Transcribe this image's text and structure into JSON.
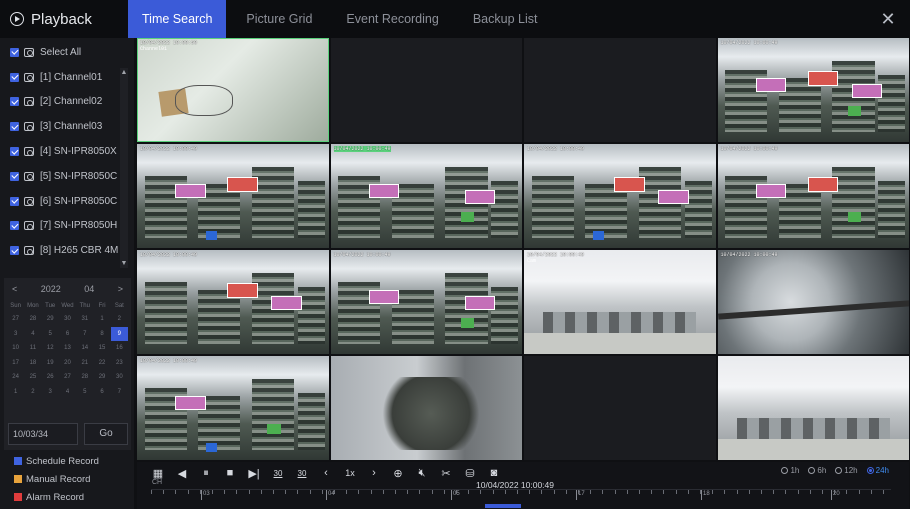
{
  "app": {
    "title": "Playback"
  },
  "tabs": [
    {
      "label": "Time Search",
      "active": true
    },
    {
      "label": "Picture Grid",
      "active": false
    },
    {
      "label": "Event Recording",
      "active": false
    },
    {
      "label": "Backup List",
      "active": false
    }
  ],
  "sidebar": {
    "select_all": "Select All",
    "channels": [
      "[1] Channel01",
      "[2] Channel02",
      "[3] Channel03",
      "[4] SN-IPR8050X",
      "[5] SN-IPR8050C",
      "[6] SN-IPR8050C",
      "[7] SN-IPR8050H",
      "[8] H265 CBR 4M"
    ]
  },
  "calendar": {
    "year": "2022",
    "month": "04",
    "prev": "<",
    "next": ">",
    "weekdays": [
      "Sun",
      "Mon",
      "Tue",
      "Wed",
      "Thu",
      "Fri",
      "Sat"
    ],
    "days": [
      "27",
      "28",
      "29",
      "30",
      "31",
      "1",
      "2",
      "3",
      "4",
      "5",
      "6",
      "7",
      "8",
      "9",
      "10",
      "11",
      "12",
      "13",
      "14",
      "15",
      "16",
      "17",
      "18",
      "19",
      "20",
      "21",
      "22",
      "23",
      "24",
      "25",
      "26",
      "27",
      "28",
      "29",
      "30",
      "1",
      "2",
      "3",
      "4",
      "5",
      "6",
      "7"
    ],
    "selected_index": 13,
    "date_input": "10/03/34",
    "go": "Go"
  },
  "legend": [
    {
      "label": "Schedule Record",
      "color": "#3f63e0"
    },
    {
      "label": "Manual Record",
      "color": "#e8a33c"
    },
    {
      "label": "Alarm Record",
      "color": "#e03c3c"
    }
  ],
  "osd": {
    "c1": "10/04/2022 10:00:50",
    "c1b": "Channel01",
    "c4": "10/04/2022 10:00:49",
    "c5": "10/04/2022 10:00:49",
    "c6": "10/04/2022 10:00:49",
    "c7": "10/04/2022 10:00:49",
    "c8": "10/04/2022 10:00:49",
    "c9": "10/04/2022 10:00:49",
    "c10": "10/04/2022 10:00:49",
    "c11": "10/04/2022 10:00:49",
    "c11b": "Cam",
    "c12": "10/04/2022 10:00:49",
    "c13": "10/04/2022 10:00:49"
  },
  "controls": {
    "ch_label": "CH",
    "speed": "1x",
    "skip30_back": "30",
    "skip30_fwd": "30",
    "timestamp": "10/04/2022 10:00:49",
    "ranges": [
      {
        "label": "1h",
        "on": false
      },
      {
        "label": "6h",
        "on": false
      },
      {
        "label": "12h",
        "on": false
      },
      {
        "label": "24h",
        "on": true
      }
    ],
    "timeline_labels": [
      "03",
      "04",
      "05",
      "17",
      "18",
      "20"
    ]
  },
  "colors": {
    "accent": "#3b5bd8",
    "selected_cell": "#5ad17c"
  }
}
